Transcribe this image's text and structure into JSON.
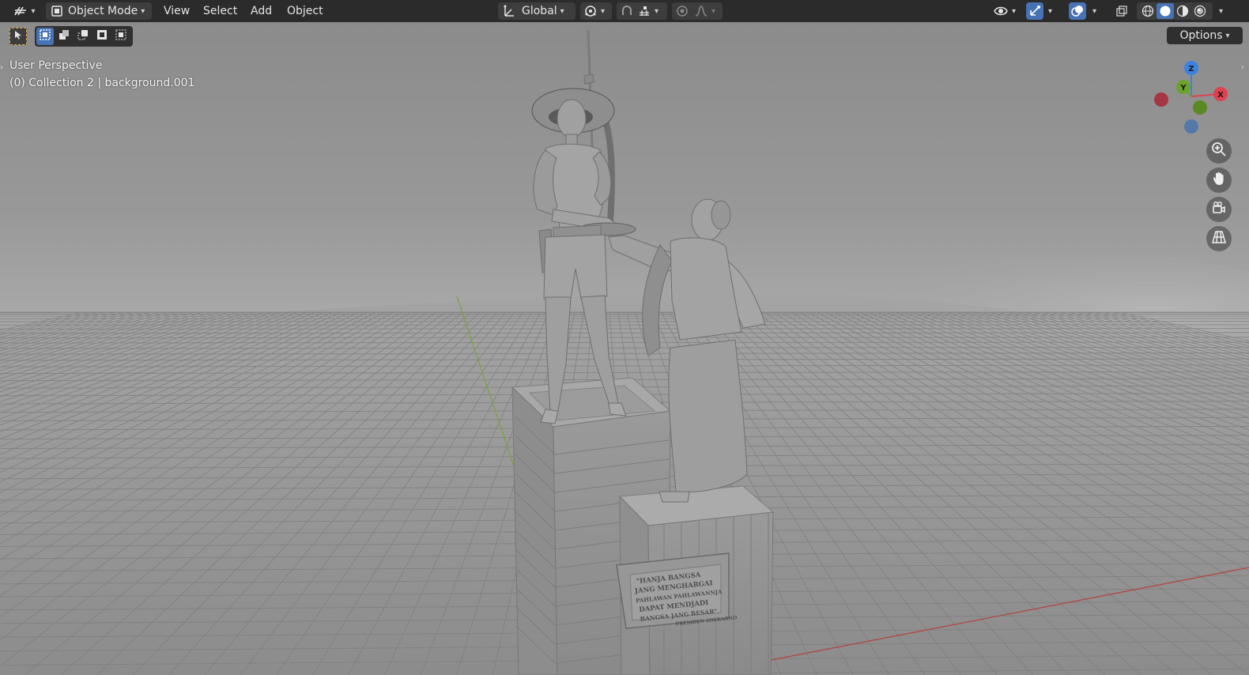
{
  "header": {
    "mode_label": "Object Mode",
    "menus": [
      "View",
      "Select",
      "Add",
      "Object"
    ],
    "transform_orientation": "Global",
    "accent": "#4772b3"
  },
  "toolbar": {
    "options_label": "Options"
  },
  "viewport": {
    "view_name": "User Perspective",
    "collection_info": "(0) Collection 2 | background.001"
  },
  "gizmo": {
    "z": "Z",
    "y": "Y",
    "x": "X",
    "colors": {
      "x": "#e0414f",
      "y": "#6ba22a",
      "z": "#3c82e0"
    }
  },
  "plaque": {
    "lines": [
      "\"HANJA BANGSA",
      "JANG MENGHARGAI",
      "PAHLAWAN PAHLAWANNJA",
      "DAPAT MENDJADI",
      "BANGSA JANG BESAR\"",
      "PRESIDEN SOEKARNO"
    ]
  },
  "icons": {
    "editor_type": "editor-type-icon",
    "object_mode": "object-mode-icon",
    "orientation": "orientation-icon",
    "pivot": "pivot-point-icon",
    "snap": "snap-icon",
    "snap_increment": "snap-increment-icon",
    "proportional": "proportional-editing-icon",
    "falloff": "falloff-curve-icon",
    "visibility": "visibility-icon",
    "gizmo": "gizmo-icon",
    "overlays": "overlays-icon",
    "xray": "xray-icon",
    "wireframe": "wireframe-shading-icon",
    "solid": "solid-shading-icon",
    "material": "material-preview-icon",
    "rendered": "rendered-shading-icon",
    "zoom": "zoom-icon",
    "pan": "hand-pan-icon",
    "camera": "camera-view-icon",
    "grid": "ortho-grid-icon"
  }
}
